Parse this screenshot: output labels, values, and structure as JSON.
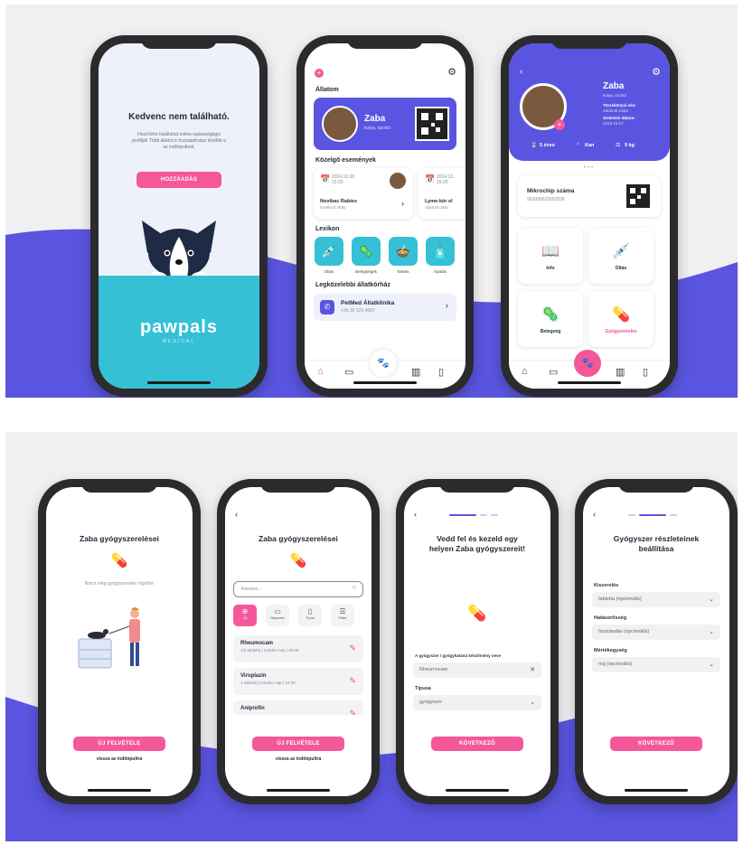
{
  "colors": {
    "accent": "#5a55e0",
    "pink": "#f4589a",
    "teal": "#35c0d6"
  },
  "top": {
    "phone1": {
      "heading": "Kedvenc nem található.",
      "body": "Hozd létre kisállatod online egészségügyi profilját! Több állatot is hozzáadhatsz később a az indítópultnál.",
      "button": "HOZZÁADÁS",
      "brand": "pawpals",
      "brand_sub": "MEDICAL"
    },
    "phone2": {
      "section_pets": "Állatom",
      "pet_name": "Zaba",
      "pet_breed": "kutya, tacskó",
      "section_events": "Közelgő események",
      "events": [
        {
          "date": "2024.12.08",
          "time": "15:00",
          "title": "Novibac Rabies",
          "subtitle": "Kötelező oltás"
        },
        {
          "date": "2024.12.",
          "time": "15:00",
          "title": "Lyme-kór el",
          "subtitle": "Ajánlott oltás"
        }
      ],
      "section_lexicon": "Lexikon",
      "lexicon": [
        "Oltás",
        "Betegségek",
        "Etetés",
        "Ápolás"
      ],
      "section_hospital": "Legközelebbi állatkórház",
      "hospital_name": "PetMed Állatklinika",
      "hospital_phone": "+36 30 123 4567"
    },
    "phone3": {
      "pet_name": "Zaba",
      "pet_breed": "kutya, tacskó",
      "reg_name_label": "Törzskönyvi név:",
      "reg_name": "Zabánál Zaba",
      "birth_label": "Születési dátum:",
      "birth": "2019.10.17",
      "age": "5 éves",
      "sex": "Kan",
      "weight": "9 kg",
      "chip_label": "Mikrochip száma",
      "chip_number": "953000010593328",
      "tiles": [
        "Info",
        "Oltás",
        "Betegség",
        "Gyógyszerelés"
      ]
    }
  },
  "bottom": {
    "phone4": {
      "title": "Zaba gyógyszerelései",
      "empty": "Nincs még gyógyszerelés rögzítve",
      "button": "ÚJ FELVÉTELE",
      "link": "vissza az indítópultra"
    },
    "phone5": {
      "title": "Zaba gyógyszerelései",
      "search_placeholder": "Keresés...",
      "filters": [
        "Új",
        "Naponta",
        "Típus",
        "Filter"
      ],
      "items": [
        {
          "name": "Rheumocam",
          "detail": "1/3 tabletta | minden nap | 19:30"
        },
        {
          "name": "Viroplazin",
          "detail": "1 tabletta | minden nap | 10:30"
        },
        {
          "name": "Aniprofin",
          "detail": ""
        }
      ],
      "button": "ÚJ FELVÉTELE",
      "link": "vissza az indítópultra"
    },
    "phone6": {
      "title": "Vedd fel és kezeld egy helyen Zaba gyógyszereit!",
      "name_label": "A gyógyszer / gyógyhatású készítmény neve",
      "name_value": "Rheumocam",
      "type_label": "Típusa",
      "type_value": "gyógyszer",
      "button": "KÖVETKEZŐ",
      "step": 1,
      "steps": 3
    },
    "phone7": {
      "title": "Gyógyszer részleteinek beállítása",
      "fields": [
        {
          "label": "Kiszerelés",
          "value": "tabletta (opcionális)"
        },
        {
          "label": "Hatáserősség",
          "value": "hozzáadás (opcionális)"
        },
        {
          "label": "Mértékegység",
          "value": "mg (opcionális)"
        }
      ],
      "button": "KÖVETKEZŐ",
      "step": 2,
      "steps": 3
    }
  }
}
